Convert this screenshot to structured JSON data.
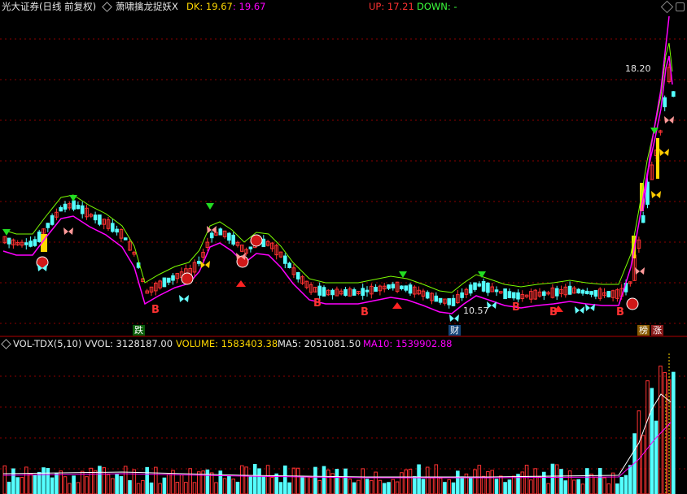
{
  "header": {
    "security": "光大证券(日线 前复权)",
    "indicator": "萧啸擒龙捉妖X",
    "dk_label": "DK: 19.67",
    "dk_value": ": 19.67",
    "up_label": "UP: 17.21",
    "down_label": "DOWN: -"
  },
  "price_labels": {
    "high": "18.20",
    "low": "10.57"
  },
  "markers": {
    "die": "跌",
    "cai": "财",
    "bang": "榜",
    "zhang": "涨",
    "b": "B"
  },
  "volume_header": {
    "name": "VOL-TDX(5,10)",
    "vvol": "VVOL: 3128187.00",
    "volume": "VOLUME: 1583403.38",
    "ma5": "MA5: 2051081.50",
    "ma10": "MA10: 1539902.88"
  },
  "colors": {
    "up": "#ff3232",
    "down": "#54ffff",
    "ma_green": "#7cfc00",
    "ma_magenta": "#ff00ff",
    "yellow": "#ffd800",
    "grid": "#8b0000"
  },
  "icons": {
    "window_controls": [
      "diamond-icon",
      "square-icon"
    ]
  }
}
